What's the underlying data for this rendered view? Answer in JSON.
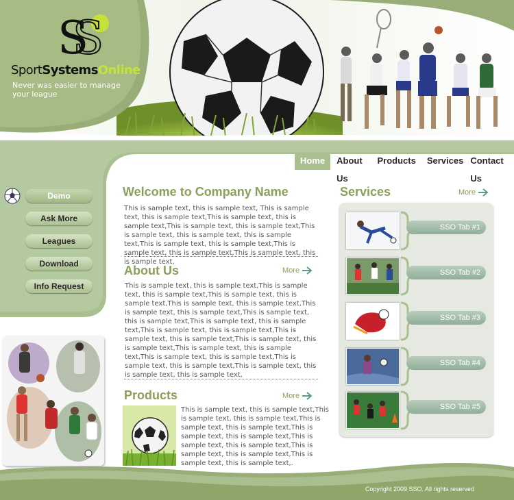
{
  "brand": {
    "logo_word1": "Sport",
    "logo_word2": "Systems",
    "logo_word3": "Online",
    "tagline": "Never was easier to manage your league",
    "accent_green": "#8aa05a",
    "lime": "#c6e23a",
    "panel_green": "#a9bf90"
  },
  "nav": {
    "items": [
      "Home",
      "About Us",
      "Products",
      "Services",
      "Contact Us"
    ],
    "active": "Home"
  },
  "sidebar": {
    "buttons": [
      "Demo",
      "Ask More",
      "Leagues",
      "Download",
      "Info Request"
    ],
    "active": "Demo",
    "icon": "soccer-ball-icon"
  },
  "welcome": {
    "title": "Welcome to Company Name",
    "text": "This is sample text, this is sample text, This is sample text, this is sample text,This is sample text, this is sample text,This is sample text, this is sample text,This is sample text, this is sample text, this is sample text,This is sample text, this is sample text,This is sample text, this is sample text,This is sample text, this is sample text,"
  },
  "about": {
    "title": "About Us",
    "more": "More",
    "text": "This is sample text, this is sample text,This is sample text, this is sample text,This is sample text, this is sample text,This is sample text, this is sample text,This is sample text, this is sample text,This is sample text, this is sample text,This is sample text, this is sample text,This is sample text, this is sample text,This is sample text, this is sample text,This is sample text, this is sample text,This is sample text, this is sample text,This is sample text, this is sample text,This is sample text, this is sample text,This is sample text, this is sample text, this is sample text,"
  },
  "products": {
    "title": "Products",
    "more": "More",
    "text": "This is sample text, this is sample text,This is sample text, this is sample text,This is sample text, this is sample text,This is sample text, this is sample text,This is sample text, this is sample text,This is sample text, this is sample text,This is sample text, this is sample text,."
  },
  "services": {
    "title": "Services",
    "more": "More",
    "tabs": [
      "SSO Tab #1",
      "SSO Tab #2",
      "SSO Tab #3",
      "SSO Tab #4",
      "SSO Tab #5"
    ]
  },
  "footer": {
    "copyright": "Copyright 2009 SSO. All rights reserved"
  }
}
